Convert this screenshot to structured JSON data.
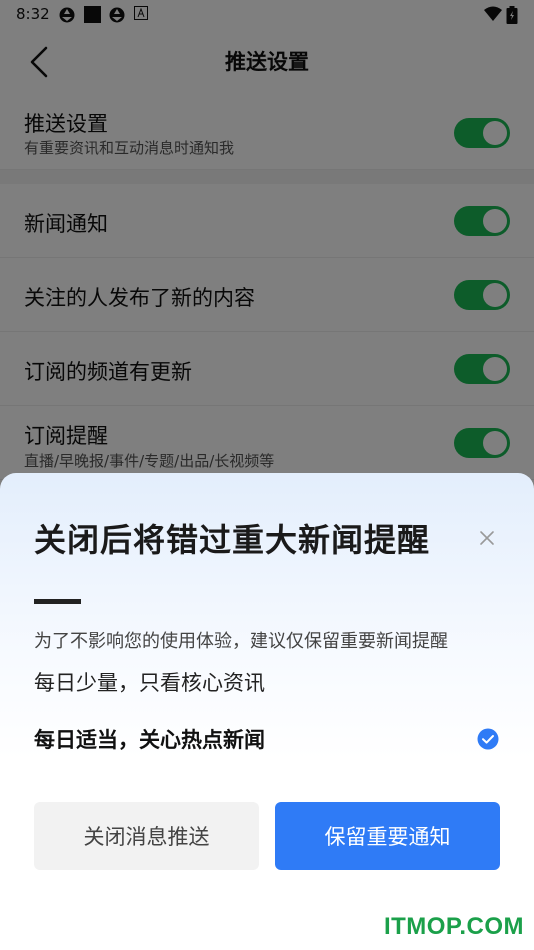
{
  "status_bar": {
    "time": "8:32",
    "icons": [
      "aperture-icon",
      "black-square-icon",
      "aperture-icon",
      "a-box-icon",
      "wifi-icon",
      "battery-icon"
    ]
  },
  "nav": {
    "title": "推送设置",
    "back_icon": "chevron-left-icon"
  },
  "settings": {
    "master": {
      "title": "推送设置",
      "subtitle": "有重要资讯和互动消息时通知我",
      "enabled": true
    },
    "items": [
      {
        "title": "新闻通知",
        "enabled": true
      },
      {
        "title": "关注的人发布了新的内容",
        "enabled": true
      },
      {
        "title": "订阅的频道有更新",
        "enabled": true
      },
      {
        "title": "订阅提醒",
        "subtitle": "直播/早晚报/事件/专题/出品/长视频等",
        "enabled": true
      }
    ],
    "toggle_color": "#1bb955"
  },
  "sheet": {
    "title": "关闭后将错过重大新闻提醒",
    "close_icon": "close-icon",
    "hint": "为了不影响您的使用体验，建议仅保留重要新闻提醒",
    "options": [
      {
        "label": "每日少量，只看核心资讯",
        "selected": false
      },
      {
        "label": "每日适当，关心热点新闻",
        "selected": true
      }
    ],
    "btn_off": "关闭消息推送",
    "btn_keep": "保留重要通知",
    "accent": "#2f7bf6"
  },
  "watermark": "ITMOP.COM"
}
